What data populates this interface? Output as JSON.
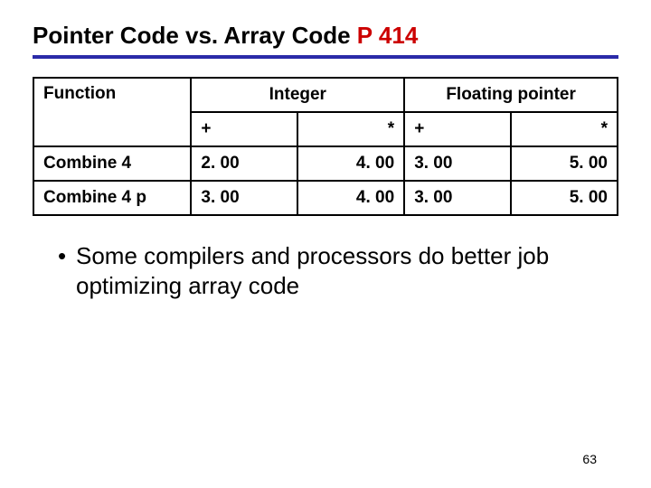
{
  "title": {
    "main": "Pointer Code vs. Array Code ",
    "accent": "P 414"
  },
  "table": {
    "headers": {
      "function": "Function",
      "group1": "Integer",
      "group2": "Floating pointer",
      "sub_plus": "+",
      "sub_star": "*"
    },
    "rows": [
      {
        "fn": "Combine 4",
        "int_plus": "2. 00",
        "int_star": "4. 00",
        "fp_plus": "3. 00",
        "fp_star": "5. 00"
      },
      {
        "fn": "Combine 4 p",
        "int_plus": "3. 00",
        "int_star": "4. 00",
        "fp_plus": "3. 00",
        "fp_star": "5. 00"
      }
    ]
  },
  "bullet": "Some compilers and processors do better job optimizing array code",
  "page_number": "63",
  "chart_data": {
    "type": "table",
    "title": "Pointer Code vs. Array Code P 414",
    "columns": [
      "Function",
      "Integer +",
      "Integer *",
      "Floating pointer +",
      "Floating pointer *"
    ],
    "rows": [
      [
        "Combine 4",
        2.0,
        4.0,
        3.0,
        5.0
      ],
      [
        "Combine 4 p",
        3.0,
        4.0,
        3.0,
        5.0
      ]
    ]
  }
}
